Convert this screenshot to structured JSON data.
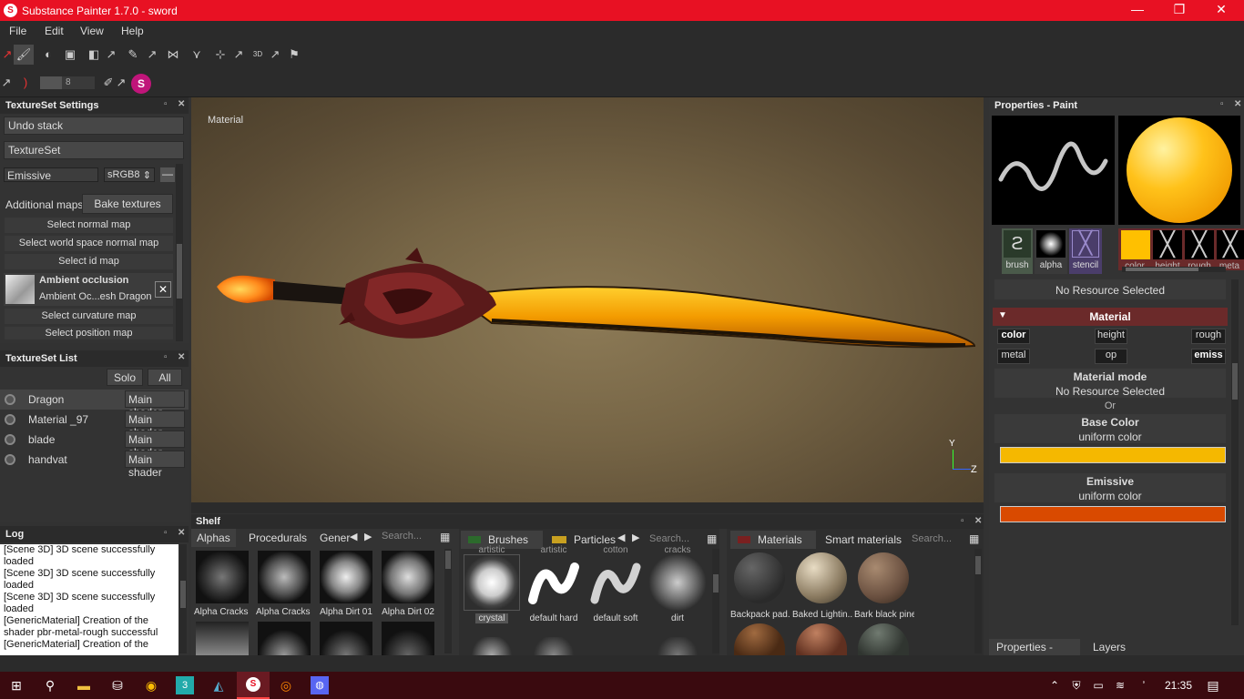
{
  "window": {
    "title": "Substance Painter 1.7.0 - sword",
    "app_icon": "S",
    "minimize": "—",
    "maximize": "❐",
    "close": "✕"
  },
  "menu": [
    "File",
    "Edit",
    "View",
    "Help"
  ],
  "toolbar": {
    "brush_size": "8"
  },
  "textureset_settings": {
    "title": "TextureSet Settings",
    "undo_stack": "Undo stack",
    "textureset": "TextureSet",
    "channel": "Emissive",
    "format": "sRGB8",
    "additional_maps": "Additional maps",
    "bake": "Bake textures",
    "maps": [
      "Select normal map",
      "Select world space normal map",
      "Select id map"
    ],
    "ao_title": "Ambient occlusion",
    "ao_value": "Ambient Oc...esh Dragon",
    "after": [
      "Select curvature map",
      "Select position map"
    ]
  },
  "textureset_list": {
    "title": "TextureSet List",
    "solo": "Solo",
    "all": "All",
    "items": [
      {
        "name": "Dragon",
        "shader": "Main shader"
      },
      {
        "name": "Material _97",
        "shader": "Main shader"
      },
      {
        "name": "blade",
        "shader": "Main shader"
      },
      {
        "name": "handvat",
        "shader": "Main shader"
      }
    ]
  },
  "log": {
    "title": "Log",
    "lines": [
      "[Scene 3D] 3D scene successfully",
      "loaded",
      "[Scene 3D] 3D scene successfully",
      "loaded",
      "[Scene 3D] 3D scene successfully",
      "loaded",
      "[GenericMaterial] Creation of the",
      "shader pbr-metal-rough successful",
      "[GenericMaterial] Creation of the"
    ]
  },
  "viewport": {
    "label": "Material",
    "axis_y": "Y",
    "axis_z": "Z"
  },
  "shelf": {
    "title": "Shelf",
    "tabs_left": [
      "Alphas",
      "Procedurals",
      "Gener"
    ],
    "search": "Search...",
    "alphas": [
      "Alpha Cracks ...",
      "Alpha Cracks ...",
      "Alpha Dirt 01",
      "Alpha Dirt 02"
    ],
    "tab_brushes": "Brushes",
    "tab_particles": "Particles",
    "brushes": [
      "crystal",
      "default hard",
      "default soft",
      "dirt"
    ],
    "brush_top": [
      "artistic",
      "artistic",
      "cotton",
      "cracks"
    ],
    "tab_materials": "Materials",
    "tab_smart": "Smart materials",
    "materials": [
      "Backpack pad...",
      "Baked Lightin...",
      "Bark black pine"
    ]
  },
  "properties": {
    "title": "Properties - Paint",
    "slots": [
      "brush",
      "alpha",
      "stencil"
    ],
    "channels": [
      "color",
      "height",
      "rough",
      "meta"
    ],
    "no_resource": "No Resource Selected",
    "material_title": "Material",
    "chips_row1": [
      "color",
      "height",
      "rough"
    ],
    "chips_row2": [
      "metal",
      "op",
      "emiss"
    ],
    "material_mode": "Material mode",
    "material_mode_value": "No Resource Selected",
    "or": "Or",
    "base_color": "Base Color",
    "base_color_mode": "uniform color",
    "base_color_hex": "#f5b800",
    "emissive": "Emissive",
    "emissive_mode": "uniform color",
    "emissive_hex": "#d94a00",
    "bottom_tabs": [
      "Properties - Paint",
      "Layers"
    ]
  },
  "taskbar": {
    "time": "21:35"
  }
}
